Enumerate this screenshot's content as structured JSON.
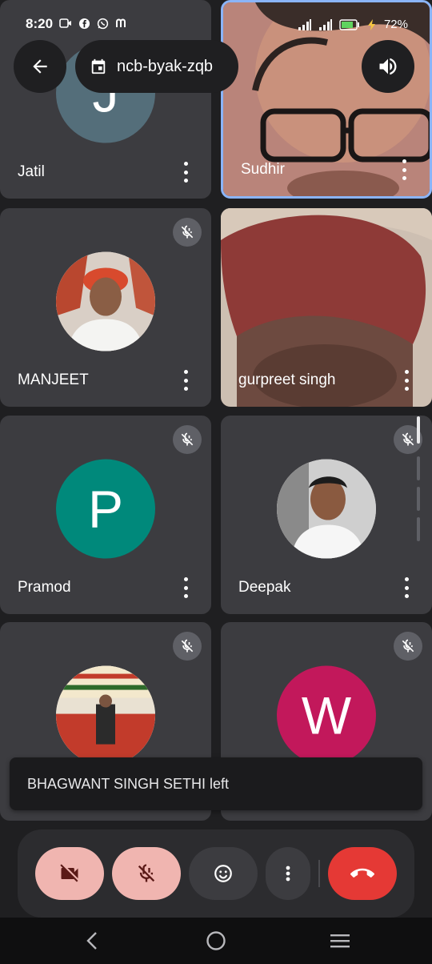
{
  "status": {
    "time": "8:20",
    "battery": "72%",
    "left_icons": [
      "video-call-icon",
      "facebook-icon",
      "whatsapp-icon",
      "app-m-icon"
    ],
    "right_icons": [
      "signal-icon",
      "signal-icon",
      "battery-icon",
      "charging-icon"
    ]
  },
  "header": {
    "meeting_code": "ncb-byak-zqb",
    "back_icon": "arrow-back-icon",
    "calendar_icon": "calendar-icon",
    "audio_icon": "speaker-icon"
  },
  "participants": [
    {
      "name": "Jatil",
      "initial": "J",
      "avatar_color": "#546e7a",
      "muted": false,
      "type": "initial"
    },
    {
      "name": "Sudhir",
      "muted": false,
      "type": "video",
      "speaking": true
    },
    {
      "name": "MANJEET",
      "muted": true,
      "type": "photo"
    },
    {
      "name": "gurpreet singh",
      "muted": false,
      "type": "video"
    },
    {
      "name": "Pramod",
      "initial": "P",
      "avatar_color": "#00897b",
      "muted": true,
      "type": "initial"
    },
    {
      "name": "Deepak",
      "muted": true,
      "type": "photo"
    },
    {
      "name": "",
      "muted": true,
      "type": "photo"
    },
    {
      "name": "",
      "initial": "W",
      "avatar_color": "#c2185b",
      "muted": true,
      "type": "initial"
    }
  ],
  "toast": {
    "message": "BHAGWANT SINGH SETHI left"
  },
  "controls": {
    "camera": "camera-off-icon",
    "mic": "mic-off-icon",
    "reactions": "emoji-icon",
    "more": "more-vert-icon",
    "end": "call-end-icon",
    "accent_off": "#f0b5b0",
    "end_color": "#e53935"
  },
  "nav": [
    "nav-back-icon",
    "nav-home-icon",
    "nav-recents-icon"
  ]
}
